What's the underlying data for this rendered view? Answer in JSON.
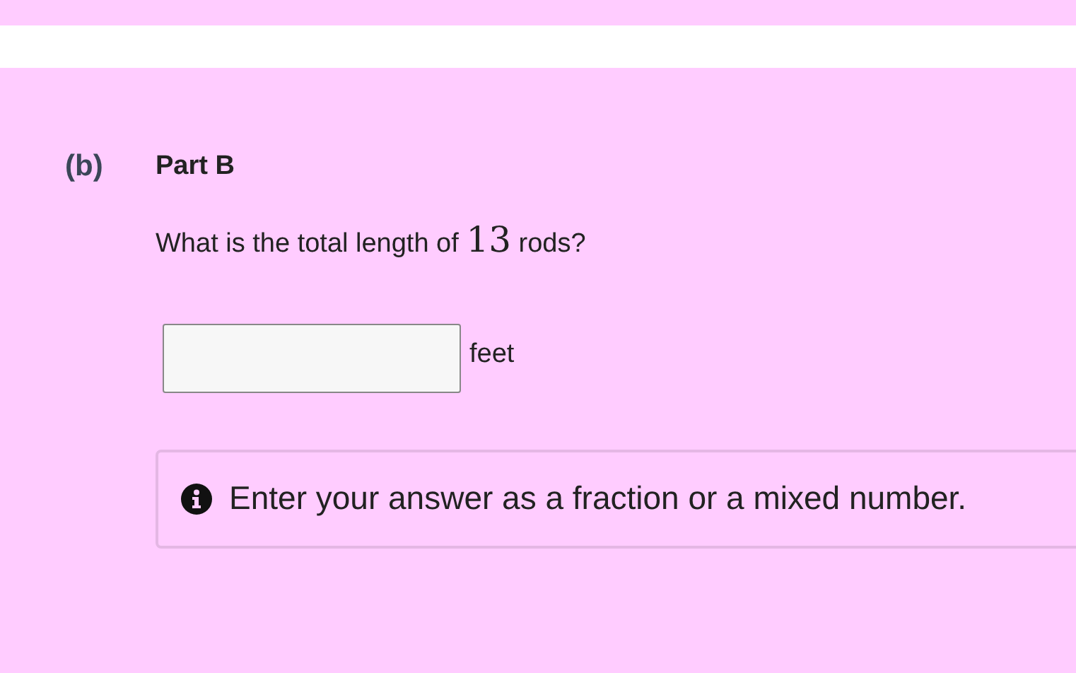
{
  "part": {
    "label": "(b)",
    "title": "Part B"
  },
  "question": {
    "before": "What is the total length of ",
    "math": "13",
    "after": " rods?"
  },
  "answer": {
    "unit": "feet"
  },
  "hint": {
    "text": "Enter your answer as a fraction or a mixed number."
  }
}
